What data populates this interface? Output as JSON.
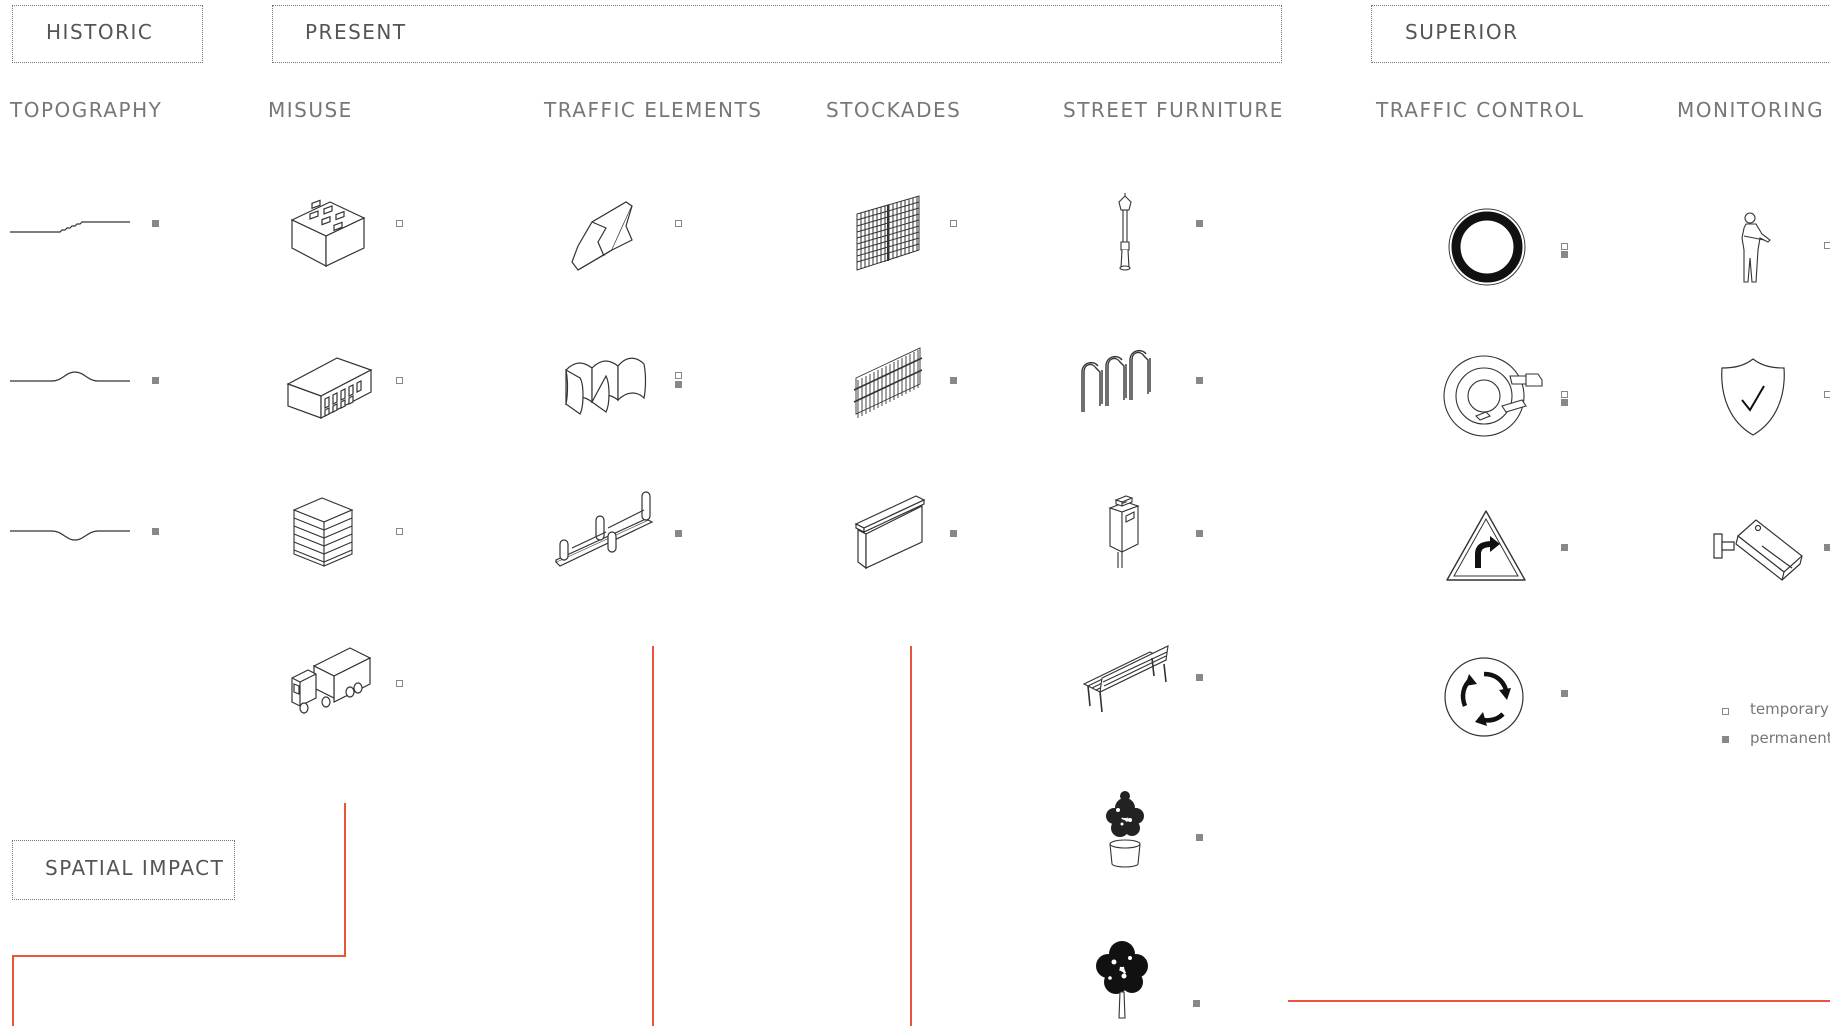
{
  "sections": {
    "historic": "HISTORIC",
    "present": "PRESENT",
    "superior": "SUPERIOR",
    "spatial_impact": "SPATIAL IMPACT"
  },
  "columns": {
    "topography": "TOPOGRAPHY",
    "misuse": "MISUSE",
    "traffic_elements": "TRAFFIC ELEMENTS",
    "stockades": "STOCKADES",
    "street_furniture": "STREET FURNITURE",
    "traffic_control": "TRAFFIC CONTROL",
    "monitoring": "MONITORING"
  },
  "legend": {
    "temporary": "temporary",
    "permanent": "permanent"
  },
  "items": {
    "topography": [
      {
        "icon": "step-profile-icon",
        "marker": "permanent"
      },
      {
        "icon": "bump-profile-icon",
        "marker": "permanent"
      },
      {
        "icon": "dip-profile-icon",
        "marker": "permanent"
      }
    ],
    "misuse": [
      {
        "icon": "sandbag-block-icon",
        "marker": "temporary"
      },
      {
        "icon": "container-block-icon",
        "marker": "temporary"
      },
      {
        "icon": "stacked-plates-icon",
        "marker": "temporary"
      },
      {
        "icon": "truck-icon",
        "marker": "temporary"
      }
    ],
    "traffic_elements": [
      {
        "icon": "jersey-barrier-icon",
        "marker": "temporary"
      },
      {
        "icon": "wave-barrier-icon",
        "marker": "temporary"
      },
      {
        "icon": "bollard-rail-icon",
        "marker": "permanent"
      }
    ],
    "stockades": [
      {
        "icon": "mesh-fence-icon",
        "marker": "temporary"
      },
      {
        "icon": "picket-fence-icon",
        "marker": "permanent"
      },
      {
        "icon": "concrete-wall-icon",
        "marker": "permanent"
      }
    ],
    "street_furniture": [
      {
        "icon": "street-lamp-icon",
        "marker": "permanent"
      },
      {
        "icon": "bike-rack-icon",
        "marker": "permanent"
      },
      {
        "icon": "trash-bin-icon",
        "marker": "permanent"
      },
      {
        "icon": "bench-icon",
        "marker": "permanent"
      },
      {
        "icon": "potted-plant-icon",
        "marker": "permanent"
      },
      {
        "icon": "tree-icon",
        "marker": "permanent"
      }
    ],
    "traffic_control": [
      {
        "icon": "no-entry-ring-sign-icon",
        "marker": "mixed"
      },
      {
        "icon": "roundabout-plan-icon",
        "marker": "mixed"
      },
      {
        "icon": "curve-warning-sign-icon",
        "marker": "permanent"
      },
      {
        "icon": "roundabout-sign-icon",
        "marker": "permanent"
      }
    ],
    "monitoring": [
      {
        "icon": "guard-person-icon",
        "marker": "temporary"
      },
      {
        "icon": "shield-check-icon",
        "marker": "temporary"
      },
      {
        "icon": "cctv-camera-icon",
        "marker": "permanent"
      }
    ]
  },
  "colors": {
    "accent_line": "#e8553a",
    "ink": "#333333",
    "label": "#777777",
    "marker": "#888888"
  }
}
